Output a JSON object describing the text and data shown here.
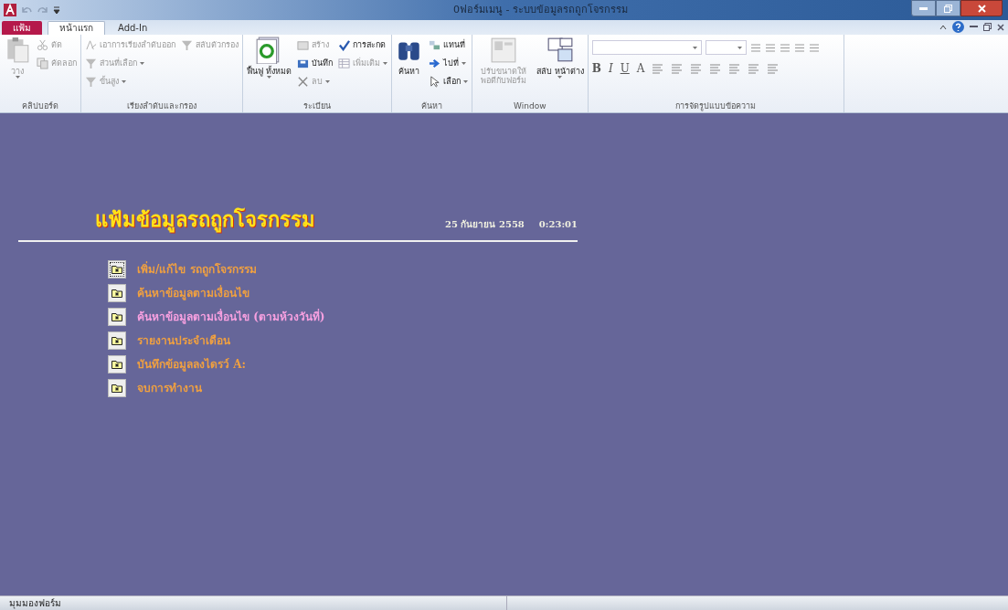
{
  "window": {
    "title": "0ฟอร์มเมนู - ระบบข้อมูลรถถูกโจรกรรม"
  },
  "tabs": [
    {
      "label": "แฟ้ม",
      "kind": "file",
      "selected": false
    },
    {
      "label": "หน้าแรก",
      "kind": "tab",
      "selected": true
    },
    {
      "label": "Add-In",
      "kind": "tab",
      "selected": false
    }
  ],
  "ribbon": [
    {
      "label": "คลิปบอร์ด",
      "items": [
        {
          "kind": "large",
          "label": "วาง",
          "disabled": true,
          "dropdown": true
        },
        {
          "kind": "small",
          "label": "ตัด",
          "disabled": true
        },
        {
          "kind": "small",
          "label": "คัดลอก",
          "disabled": true
        }
      ]
    },
    {
      "label": "เรียงลำดับและกรอง",
      "items": [
        {
          "kind": "small",
          "label": "เอาการเรียงลำดับออก",
          "disabled": true
        },
        {
          "kind": "small",
          "label": "ส่วนที่เลือก",
          "disabled": true,
          "dropdown": true
        },
        {
          "kind": "small",
          "label": "ขั้นสูง",
          "disabled": true,
          "dropdown": true
        },
        {
          "kind": "small",
          "label": "สลับตัวกรอง",
          "disabled": true
        }
      ]
    },
    {
      "label": "ระเบียน",
      "items": [
        {
          "kind": "large",
          "label": "ฟื้นฟู ทั้งหมด",
          "disabled": false,
          "dropdown": true
        },
        {
          "kind": "small",
          "label": "สร้าง",
          "disabled": true
        },
        {
          "kind": "small",
          "label": "บันทึก",
          "disabled": false
        },
        {
          "kind": "small",
          "label": "ลบ",
          "disabled": true,
          "dropdown": true
        },
        {
          "kind": "small",
          "label": "การสะกด",
          "disabled": false
        },
        {
          "kind": "small",
          "label": "เพิ่มเติม",
          "disabled": true,
          "dropdown": true
        }
      ]
    },
    {
      "label": "ค้นหา",
      "items": [
        {
          "kind": "large",
          "label": "ค้นหา",
          "disabled": false
        },
        {
          "kind": "small",
          "label": "แทนที่",
          "disabled": false
        },
        {
          "kind": "small",
          "label": "ไปที่",
          "disabled": false,
          "dropdown": true
        },
        {
          "kind": "small",
          "label": "เลือก",
          "disabled": false,
          "dropdown": true
        }
      ]
    },
    {
      "label": "Window",
      "items": [
        {
          "kind": "large",
          "label": "ปรับขนาดให้ พอดีกับฟอร์ม",
          "disabled": true
        },
        {
          "kind": "large",
          "label": "สลับ หน้าต่าง",
          "disabled": false,
          "dropdown": true
        }
      ]
    },
    {
      "label": "การจัดรูปแบบข้อความ",
      "items": [
        {
          "kind": "format"
        }
      ]
    }
  ],
  "format_buttons": [
    "B",
    "I",
    "U",
    "A"
  ],
  "form": {
    "title": "แฟ้มข้อมูลรถถูกโจรกรรม",
    "date": "25 กันยายน 2558",
    "time": "0:23:01",
    "menu": [
      {
        "label": "เพิ่ม/แก้ไข รถถูกโจรกรรม",
        "selected": true,
        "color": "#f0a040"
      },
      {
        "label": "ค้นหาข้อมูลตามเงื่อนไข",
        "selected": false,
        "color": "#f0a040"
      },
      {
        "label": "ค้นหาข้อมูลตามเงื่อนไข (ตามห้วงวันที่)",
        "selected": false,
        "color": "#f7a0e0"
      },
      {
        "label": "รายงานประจำเดือน",
        "selected": false,
        "color": "#f0a040"
      },
      {
        "label": "บันทึกข้อมูลลงไดรว์ A:",
        "selected": false,
        "color": "#f0a040"
      },
      {
        "label": "จบการทำงาน",
        "selected": false,
        "color": "#f0a040"
      }
    ]
  },
  "status_bar": {
    "text": "มุมมองฟอร์ม"
  }
}
